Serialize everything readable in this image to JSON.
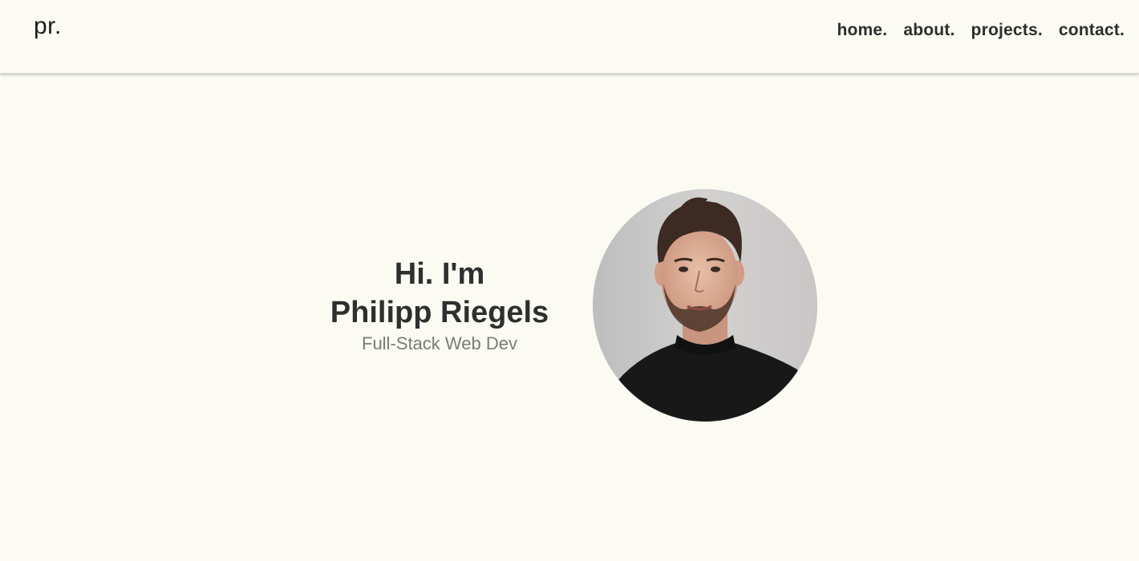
{
  "header": {
    "logo": "pr.",
    "nav": [
      {
        "label": "home."
      },
      {
        "label": "about."
      },
      {
        "label": "projects."
      },
      {
        "label": "contact."
      }
    ]
  },
  "hero": {
    "greeting": "Hi. I'm",
    "name": "Philipp Riegels",
    "role": "Full-Stack Web Dev"
  },
  "colors": {
    "background": "#fbfbf3",
    "text_dark": "#2d2d2d",
    "text_muted": "#7a7a7a"
  }
}
